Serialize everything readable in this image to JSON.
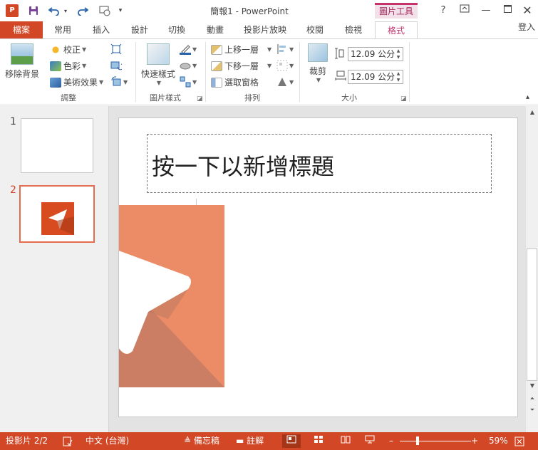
{
  "window": {
    "title": "簡報1 - PowerPoint",
    "context_tab_group": "圖片工具",
    "app_icon_letter": "P",
    "help": "?",
    "login": "登入"
  },
  "tabs": [
    {
      "label": "檔案"
    },
    {
      "label": "常用"
    },
    {
      "label": "插入"
    },
    {
      "label": "設計"
    },
    {
      "label": "切換"
    },
    {
      "label": "動畫"
    },
    {
      "label": "投影片放映"
    },
    {
      "label": "校閱"
    },
    {
      "label": "檢視"
    },
    {
      "label": "格式"
    }
  ],
  "ribbon": {
    "adjust": {
      "label": "調整",
      "remove_bg": "移除背景",
      "corrections": "校正",
      "color": "色彩",
      "artistic": "美術效果"
    },
    "picture_styles": {
      "label": "圖片樣式",
      "quick_styles": "快速樣式"
    },
    "arrange": {
      "label": "排列",
      "bring_forward": "上移一層",
      "send_backward": "下移一層",
      "selection_pane": "選取窗格"
    },
    "size": {
      "label": "大小",
      "crop": "裁剪",
      "height": "12.09 公分",
      "width": "12.09 公分"
    }
  },
  "slides": [
    {
      "number": "1"
    },
    {
      "number": "2"
    }
  ],
  "slide": {
    "title_placeholder": "按一下以新增標題"
  },
  "status": {
    "slide_count": "投影片 2/2",
    "language": "中文 (台灣)",
    "notes": "備忘稿",
    "comments": "註解",
    "zoom": "59%",
    "zoom_fraction": 0.59
  },
  "colors": {
    "accent": "#d24726",
    "context": "#c3326b",
    "picture": "#e98a65"
  }
}
